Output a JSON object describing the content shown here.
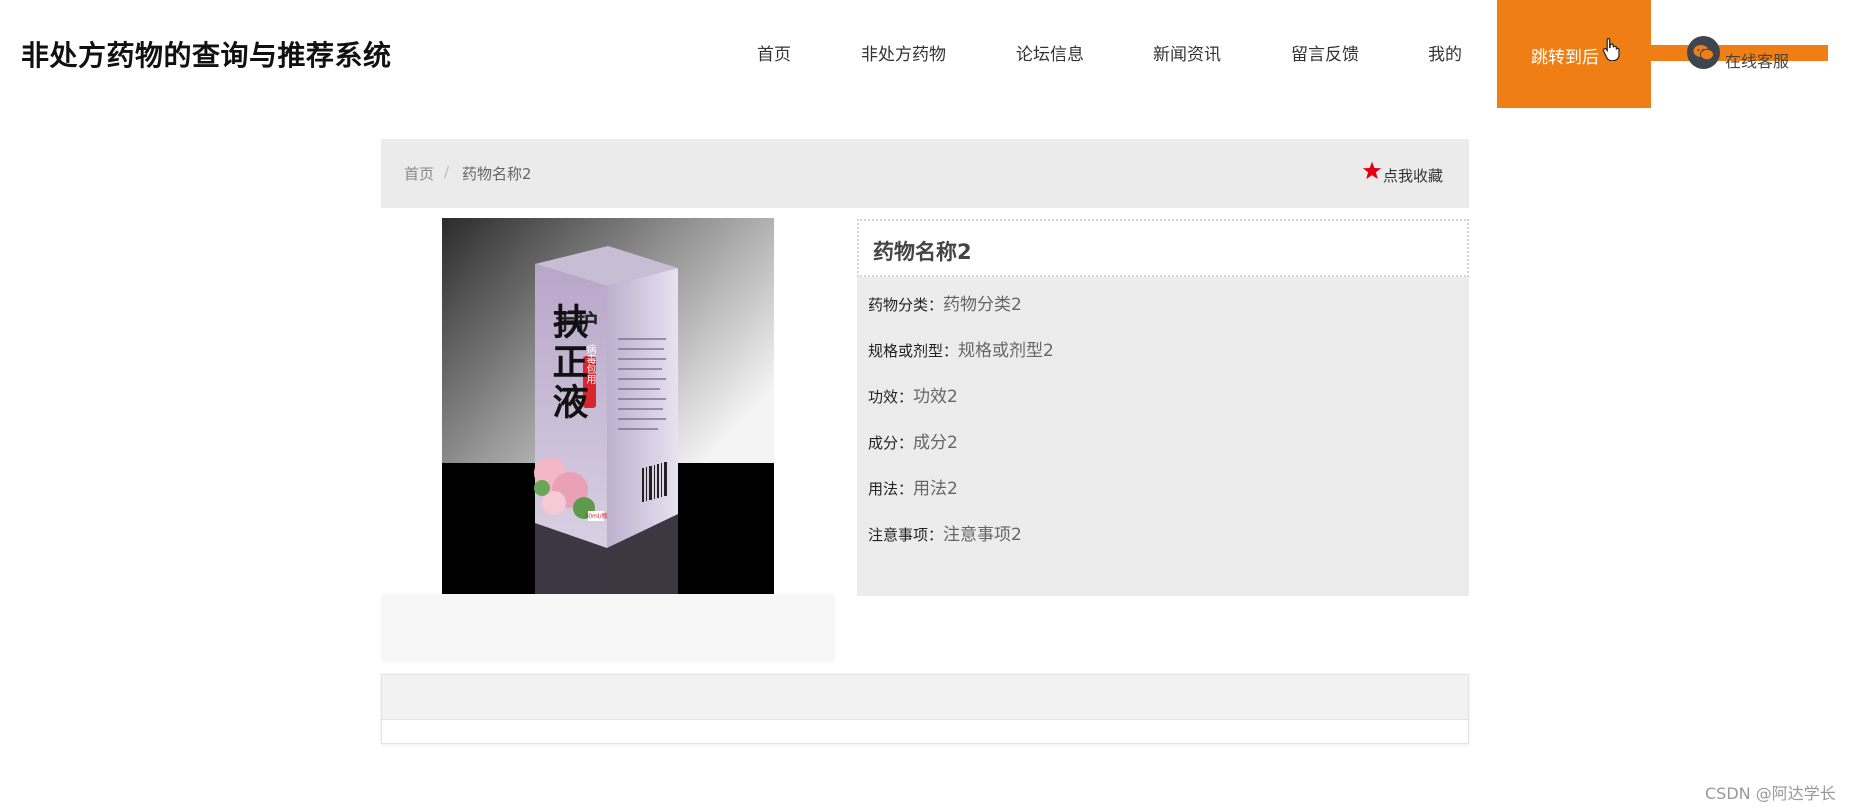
{
  "site": {
    "title": "非处方药物的查询与推荐系统"
  },
  "nav": {
    "items": [
      "首页",
      "非处方药物",
      "论坛信息",
      "新闻资讯",
      "留言反馈",
      "我的"
    ],
    "cta_label": "跳转到后",
    "service_label": "在线客服"
  },
  "breadcrumb": {
    "home": "首页",
    "separator": "/",
    "current": "药物名称2"
  },
  "favorite": {
    "label": "点我收藏"
  },
  "product": {
    "name": "药物名称2",
    "fields": [
      {
        "key": "药物分类：",
        "value": "药物分类2"
      },
      {
        "key": "规格或剂型：",
        "value": "规格或剂型2"
      },
      {
        "key": "功效：",
        "value": "功效2"
      },
      {
        "key": "成分：",
        "value": "成分2"
      },
      {
        "key": "用法：",
        "value": "用法2"
      },
      {
        "key": "注意事项：",
        "value": "注意事项2"
      }
    ],
    "package": {
      "brand": "手护",
      "name": "扶正液",
      "tag": "病毒包用",
      "volume": "30ml/瓶"
    }
  },
  "watermark": "CSDN @阿达学长",
  "colors": {
    "accent": "#ef7e14",
    "star": "#e3000f",
    "panel": "#ececec"
  },
  "icons": {
    "favorite": "star-icon",
    "service": "wechat-icon",
    "cursor": "hand-cursor-icon"
  }
}
